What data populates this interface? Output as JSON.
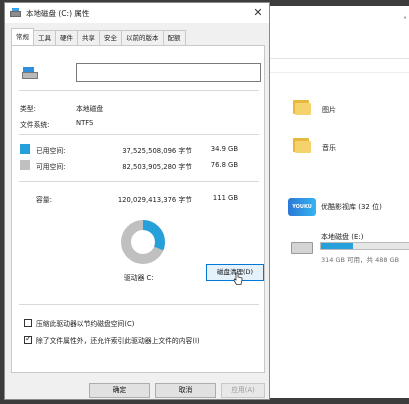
{
  "dialog": {
    "title": "本地磁盘 (C:) 属性",
    "close_glyph": "✕",
    "tabs": [
      "常规",
      "工具",
      "硬件",
      "共享",
      "安全",
      "以前的版本",
      "配额"
    ],
    "active_tab": "常规",
    "name_value": "",
    "type_label": "类型:",
    "type_value": "本地磁盘",
    "fs_label": "文件系统:",
    "fs_value": "NTFS",
    "used_label": "已用空间:",
    "used_bytes": "37,525,508,096 字节",
    "used_size": "34.9 GB",
    "free_label": "可用空间:",
    "free_bytes": "82,503,905,280 字节",
    "free_size": "76.8 GB",
    "capacity_label": "容量:",
    "capacity_bytes": "120,029,413,376 字节",
    "capacity_size": "111 GB",
    "drive_label": "驱动器 C:",
    "cleanup_button": "磁盘清理(D)",
    "compress_label": "压缩此驱动器以节约磁盘空间(C)",
    "compress_checked": false,
    "index_label": "除了文件属性外，还允许索引此驱动器上文件的内容(I)",
    "index_checked": true,
    "ok_button": "确定",
    "cancel_button": "取消",
    "apply_button": "应用(A)",
    "used_fraction": 0.312,
    "colors": {
      "used": "#26a0da",
      "free": "#c0c0c0"
    }
  },
  "explorer": {
    "items": [
      {
        "label": "图片",
        "icon": "pictures-folder-icon"
      },
      {
        "label": "音乐",
        "icon": "music-folder-icon"
      },
      {
        "label": "优酷影视库 (32 位)",
        "icon": "youku-icon",
        "icon_text": "YOUKU"
      }
    ],
    "drive": {
      "label": "本地磁盘 (E:)",
      "detail": "314 GB 可用，共 488 GB",
      "used_fraction": 0.36
    },
    "scroll_glyph": "˄"
  }
}
